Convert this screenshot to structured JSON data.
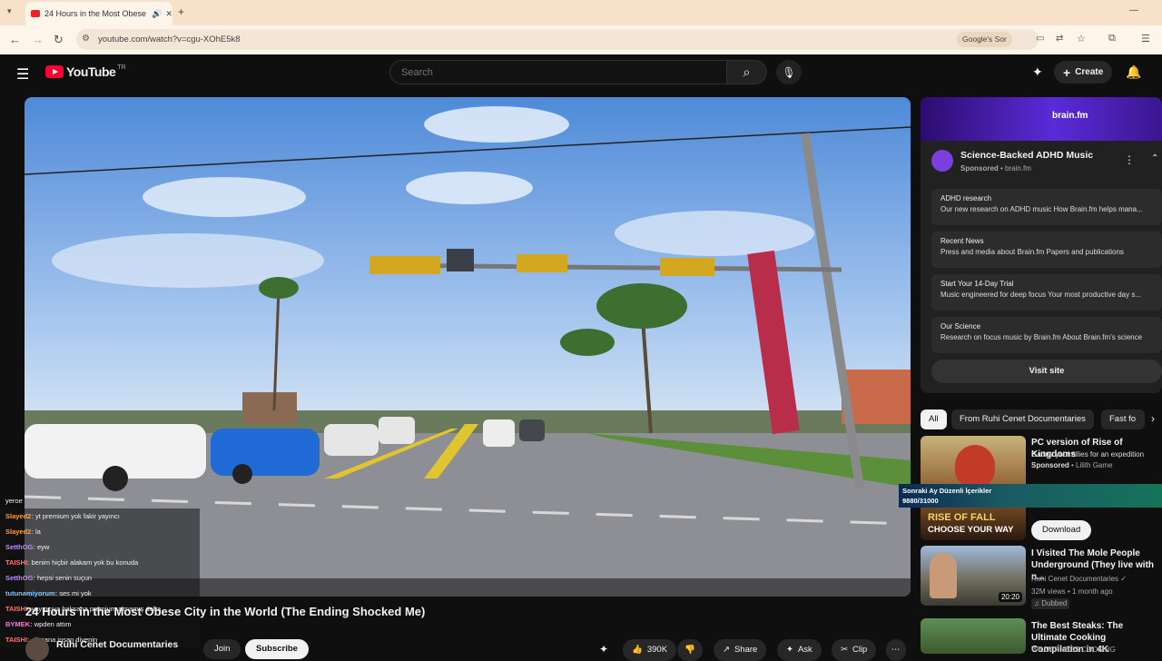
{
  "browser": {
    "tab_title": "24 Hours in the Most Obese",
    "url": "youtube.com/watch?v=cgu-XOhE5k8",
    "search_chip": "Google's Sor",
    "accent": "#f7e2c9"
  },
  "header": {
    "logo_text": "YouTube",
    "logo_country": "TR",
    "search_placeholder": "Search",
    "create_label": "Create"
  },
  "chat": [
    {
      "user": "yeroe",
      "msg": "",
      "color": "#ffffff"
    },
    {
      "user": "Slayed2:",
      "msg": "yt premium yok fakir yayıncı",
      "color": "#ff9d3a"
    },
    {
      "user": "Slayed2:",
      "msg": "la",
      "color": "#ff9d3a"
    },
    {
      "user": "SetthOG:",
      "msg": "eyw",
      "color": "#b98cff"
    },
    {
      "user": "TAISHI:",
      "msg": "benim hiçbir alakam yok bu konuda",
      "color": "#ff7777"
    },
    {
      "user": "SetthOG:",
      "msg": "hepsi senin suçun",
      "color": "#b98cff"
    },
    {
      "user": "tutunamiyorum:",
      "msg": "ses mi yok",
      "color": "#7fc6ff"
    },
    {
      "user": "TAISHI:",
      "msg": "yayıncıya baksana premium almamış daha",
      "color": "#ff7777"
    },
    {
      "user": "BYMEK:",
      "msg": "wpden attım",
      "color": "#ff77dd"
    },
    {
      "user": "TAISHI:",
      "msg": "ah sana insan diyenin",
      "color": "#ff7777"
    }
  ],
  "video": {
    "title": "24 Hours in the Most Obese City in the World (The Ending Shocked Me)",
    "channel": "Ruhi Cenet Documentaries",
    "join_label": "Join",
    "subscribe_label": "Subscribe",
    "likes": "390K",
    "share_label": "Share",
    "ask_label": "Ask",
    "clip_label": "Clip"
  },
  "ad": {
    "brand": "brain.fm",
    "title": "Science-Backed ADHD Music",
    "sponsored": "Sponsored",
    "domain": "brain.fm",
    "links": [
      {
        "title": "ADHD research",
        "desc": "Our new research on ADHD music How Brain.fm helps mana..."
      },
      {
        "title": "Recent News",
        "desc": "Press and media about Brain.fm Papers and publications"
      },
      {
        "title": "Start Your 14-Day Trial",
        "desc": "Music engineered for deep focus Your most productive day s..."
      },
      {
        "title": "Our Science",
        "desc": "Research on focus music by Brain.fm About Brain.fm's science"
      }
    ],
    "visit_label": "Visit site"
  },
  "chips": [
    "All",
    "From Ruhi Cenet Documentaries",
    "Fast fo"
  ],
  "overlay": {
    "line1": "Sonraki Ay Düzenli İçerikler",
    "line2": "9880/31000"
  },
  "recommendations": [
    {
      "title": "PC version of Rise of Kingdoms",
      "line2": "Gather your allies for an expedition",
      "sponsored": "Sponsored",
      "advertiser": "Lilith Game",
      "thumb_text1": "RISE OF FALL",
      "thumb_text2": "CHOOSE YOUR WAY",
      "download_label": "Download"
    },
    {
      "title": "I Visited The Mole People Underground (They live with n...",
      "channel": "Ruhi Cenet Documentaries",
      "meta": "32M views • 1 month ago",
      "badge": "Dubbed",
      "duration": "20:20"
    },
    {
      "title": "The Best Steaks: The Ultimate Cooking Compilation in 4K",
      "channel": "WILDERNESS COOKING"
    }
  ]
}
